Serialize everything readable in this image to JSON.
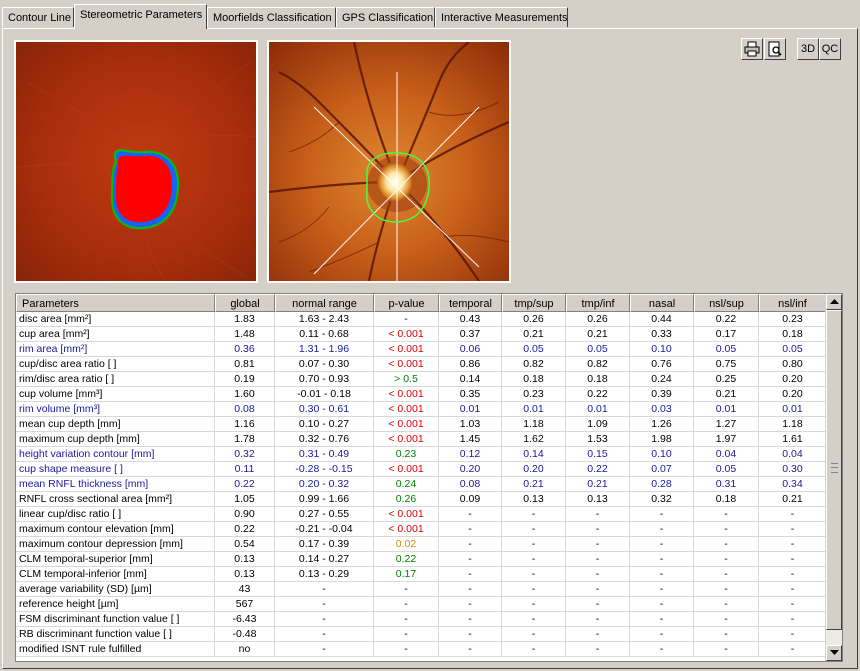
{
  "tabs": [
    {
      "label": "Contour Line",
      "active": false
    },
    {
      "label": "Stereometric Parameters",
      "active": true
    },
    {
      "label": "Moorfields Classification",
      "active": false
    },
    {
      "label": "GPS Classification",
      "active": false
    },
    {
      "label": "Interactive Measurements",
      "active": false
    }
  ],
  "toolbar": {
    "print_icon": "printer-icon",
    "preview_icon": "print-preview-icon",
    "btn_3d": "3D",
    "btn_qc": "QC"
  },
  "images": {
    "left": "topography-map-cup-rim",
    "right": "reflectance-fundus-optic-disc"
  },
  "colors": {
    "cup": "#ff0000",
    "rim": "#1060ff",
    "rim_border": "#00c000",
    "contour_line": "#40ff40",
    "normal_text": "#1a1a9a",
    "pvalue_low": "#e00000",
    "pvalue_high": "#008000",
    "pvalue_border": "#d09000"
  },
  "table": {
    "headers": [
      "Parameters",
      "global",
      "normal range",
      "p-value",
      "temporal",
      "tmp/sup",
      "tmp/inf",
      "nasal",
      "nsl/sup",
      "nsl/inf"
    ],
    "rows": [
      {
        "cells": [
          "disc area [mm²]",
          "1.83",
          "1.63 -  2.43",
          "-",
          "0.43",
          "0.26",
          "0.26",
          "0.44",
          "0.22",
          "0.23"
        ],
        "name_color": "black",
        "p_color": "black"
      },
      {
        "cells": [
          "cup area [mm²]",
          "1.48",
          "0.11 -  0.68",
          "< 0.001",
          "0.37",
          "0.21",
          "0.21",
          "0.33",
          "0.17",
          "0.18"
        ],
        "name_color": "black",
        "p_color": "red"
      },
      {
        "cells": [
          "rim area [mm²]",
          "0.36",
          "1.31 -  1.96",
          "< 0.001",
          "0.06",
          "0.05",
          "0.05",
          "0.10",
          "0.05",
          "0.05"
        ],
        "name_color": "blue",
        "p_color": "red"
      },
      {
        "cells": [
          "cup/disc area ratio [ ]",
          "0.81",
          "0.07 -  0.30",
          "< 0.001",
          "0.86",
          "0.82",
          "0.82",
          "0.76",
          "0.75",
          "0.80"
        ],
        "name_color": "black",
        "p_color": "red"
      },
      {
        "cells": [
          "rim/disc area ratio [ ]",
          "0.19",
          "0.70 -  0.93",
          "> 0.5",
          "0.14",
          "0.18",
          "0.18",
          "0.24",
          "0.25",
          "0.20"
        ],
        "name_color": "black",
        "p_color": "green"
      },
      {
        "cells": [
          "cup volume [mm³]",
          "1.60",
          "-0.01 -  0.18",
          "< 0.001",
          "0.35",
          "0.23",
          "0.22",
          "0.39",
          "0.21",
          "0.20"
        ],
        "name_color": "black",
        "p_color": "red"
      },
      {
        "cells": [
          "rim volume [mm³]",
          "0.08",
          "0.30 -  0.61",
          "< 0.001",
          "0.01",
          "0.01",
          "0.01",
          "0.03",
          "0.01",
          "0.01"
        ],
        "name_color": "blue",
        "p_color": "red"
      },
      {
        "cells": [
          "mean cup depth [mm]",
          "1.16",
          "0.10 -  0.27",
          "< 0.001",
          "1.03",
          "1.18",
          "1.09",
          "1.26",
          "1.27",
          "1.18"
        ],
        "name_color": "black",
        "p_color": "red"
      },
      {
        "cells": [
          "maximum cup depth [mm]",
          "1.78",
          "0.32 -  0.76",
          "< 0.001",
          "1.45",
          "1.62",
          "1.53",
          "1.98",
          "1.97",
          "1.61"
        ],
        "name_color": "black",
        "p_color": "red"
      },
      {
        "cells": [
          "height variation contour [mm]",
          "0.32",
          "0.31 -  0.49",
          "0.23",
          "0.12",
          "0.14",
          "0.15",
          "0.10",
          "0.04",
          "0.04"
        ],
        "name_color": "blue",
        "p_color": "green"
      },
      {
        "cells": [
          "cup shape measure [ ]",
          "0.11",
          "-0.28 -  -0.15",
          "< 0.001",
          "0.20",
          "0.20",
          "0.22",
          "0.07",
          "0.05",
          "0.30"
        ],
        "name_color": "blue",
        "p_color": "red"
      },
      {
        "cells": [
          "mean RNFL thickness [mm]",
          "0.22",
          "0.20 -  0.32",
          "0.24",
          "0.08",
          "0.21",
          "0.21",
          "0.28",
          "0.31",
          "0.34"
        ],
        "name_color": "blue",
        "p_color": "green"
      },
      {
        "cells": [
          "RNFL cross sectional area [mm²]",
          "1.05",
          "0.99 -  1.66",
          "0.26",
          "0.09",
          "0.13",
          "0.13",
          "0.32",
          "0.18",
          "0.21"
        ],
        "name_color": "black",
        "p_color": "green"
      },
      {
        "cells": [
          "linear cup/disc ratio [ ]",
          "0.90",
          "0.27 -  0.55",
          "< 0.001",
          "-",
          "-",
          "-",
          "-",
          "-",
          "-"
        ],
        "name_color": "black",
        "p_color": "red"
      },
      {
        "cells": [
          "maximum contour elevation [mm]",
          "0.22",
          "-0.21 -  -0.04",
          "< 0.001",
          "-",
          "-",
          "-",
          "-",
          "-",
          "-"
        ],
        "name_color": "black",
        "p_color": "red"
      },
      {
        "cells": [
          "maximum contour depression [mm]",
          "0.54",
          "0.17 -  0.39",
          "0.02",
          "-",
          "-",
          "-",
          "-",
          "-",
          "-"
        ],
        "name_color": "black",
        "p_color": "orange"
      },
      {
        "cells": [
          "CLM temporal-superior [mm]",
          "0.13",
          "0.14 -  0.27",
          "0.22",
          "-",
          "-",
          "-",
          "-",
          "-",
          "-"
        ],
        "name_color": "black",
        "p_color": "green"
      },
      {
        "cells": [
          "CLM temporal-inferior [mm]",
          "0.13",
          "0.13 -  0.29",
          "0.17",
          "-",
          "-",
          "-",
          "-",
          "-",
          "-"
        ],
        "name_color": "black",
        "p_color": "green"
      },
      {
        "cells": [
          "average variability (SD) [µm]",
          "43",
          "-",
          "-",
          "-",
          "-",
          "-",
          "-",
          "-",
          "-"
        ],
        "name_color": "black",
        "p_color": "black"
      },
      {
        "cells": [
          "reference height [µm]",
          "567",
          "-",
          "-",
          "-",
          "-",
          "-",
          "-",
          "-",
          "-"
        ],
        "name_color": "black",
        "p_color": "black"
      },
      {
        "cells": [
          "FSM discriminant function value [ ]",
          "-6.43",
          "-",
          "-",
          "-",
          "-",
          "-",
          "-",
          "-",
          "-"
        ],
        "name_color": "black",
        "p_color": "black"
      },
      {
        "cells": [
          "RB discriminant function value [ ]",
          "-0.48",
          "-",
          "-",
          "-",
          "-",
          "-",
          "-",
          "-",
          "-"
        ],
        "name_color": "black",
        "p_color": "black"
      },
      {
        "cells": [
          "modified ISNT rule fulfilled",
          "no",
          "-",
          "-",
          "-",
          "-",
          "-",
          "-",
          "-",
          "-"
        ],
        "name_color": "black",
        "p_color": "black"
      }
    ]
  }
}
